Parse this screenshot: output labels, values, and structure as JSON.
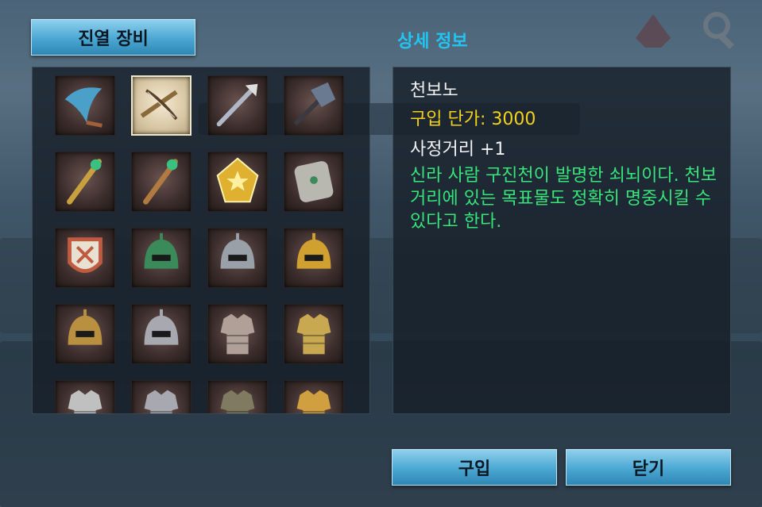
{
  "header": {
    "tab_title": "진열 장비",
    "section_title": "상세 정보"
  },
  "item": {
    "name": "천보노",
    "price_label": "구입 단가: 3000",
    "range_label": "사정거리 +1",
    "description": "신라 사람 구진천이 발명한 쇠뇌이다. 천보 거리에 있는 목표물도 정확히 명중시킬 수 있다고 한다."
  },
  "buttons": {
    "buy": "구입",
    "close": "닫기"
  },
  "grid": {
    "selected_index": 1,
    "items": [
      {
        "icon": "curved-blade-icon",
        "color": "#4aa0c8"
      },
      {
        "icon": "crossbow-icon",
        "color": "#8a6a3a"
      },
      {
        "icon": "spear-icon",
        "color": "#b0b8c8"
      },
      {
        "icon": "battle-axe-icon",
        "color": "#6a7a90"
      },
      {
        "icon": "golden-staff-icon",
        "color": "#c8a040"
      },
      {
        "icon": "bronze-staff-icon",
        "color": "#b07a40"
      },
      {
        "icon": "gold-emblem-icon",
        "color": "#e0b030"
      },
      {
        "icon": "silver-plate-icon",
        "color": "#b8b8b0"
      },
      {
        "icon": "tribal-shield-icon",
        "color": "#c05a40"
      },
      {
        "icon": "green-helmet-icon",
        "color": "#3a8a5a"
      },
      {
        "icon": "steel-helmet-icon",
        "color": "#9aa0a8"
      },
      {
        "icon": "golden-helmet-icon",
        "color": "#d0a030"
      },
      {
        "icon": "crested-helmet-icon",
        "color": "#b89040"
      },
      {
        "icon": "iron-helmet-icon",
        "color": "#a8a8b0"
      },
      {
        "icon": "chain-armor-icon",
        "color": "#b0a098"
      },
      {
        "icon": "gold-armor-icon",
        "color": "#c8a850"
      },
      {
        "icon": "light-armor-icon",
        "color": "#c0c0c0"
      },
      {
        "icon": "silver-armor-icon",
        "color": "#a8a8b0"
      },
      {
        "icon": "dark-armor-icon",
        "color": "#807a60"
      },
      {
        "icon": "ornate-armor-icon",
        "color": "#d0a040"
      }
    ]
  },
  "colors": {
    "accent_title": "#22c4f2",
    "price": "#f4d21c",
    "description": "#37e57a"
  }
}
